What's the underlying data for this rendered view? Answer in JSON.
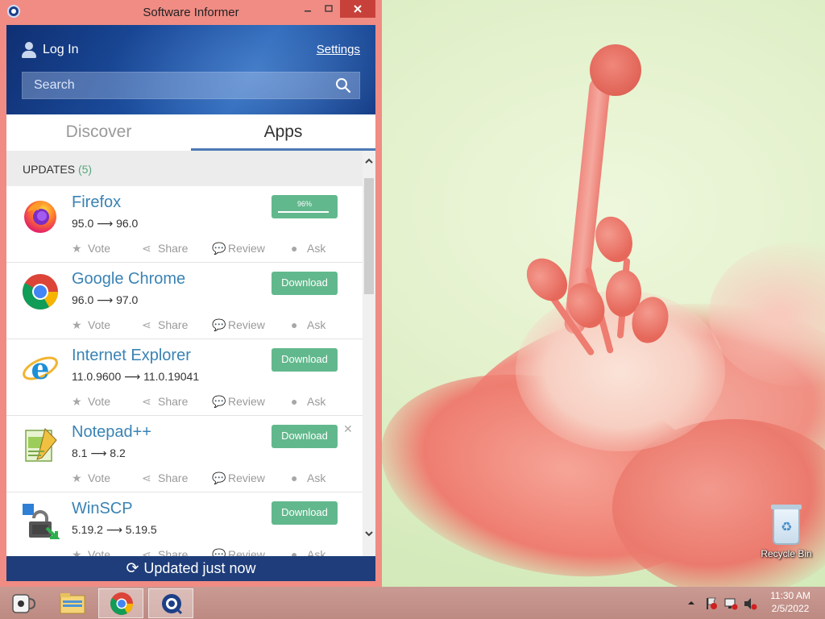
{
  "window": {
    "title": "Software Informer",
    "minimize": "▭",
    "maximize": "□",
    "close": "✕"
  },
  "header": {
    "login_label": "Log In",
    "settings_label": "Settings",
    "search_placeholder": "Search"
  },
  "tabs": [
    {
      "label": "Discover",
      "active": false
    },
    {
      "label": "Apps",
      "active": true
    }
  ],
  "updates": {
    "label": "UPDATES",
    "count": "(5)"
  },
  "actions": {
    "vote": "Vote",
    "share": "Share",
    "review": "Review",
    "ask": "Ask"
  },
  "apps": [
    {
      "name": "Firefox",
      "version": "95.0 ⟶ 96.0",
      "status": "progress",
      "progress_label": "96%",
      "progress_value": 0.96,
      "icon": "firefox-icon"
    },
    {
      "name": "Google Chrome",
      "version": "96.0 ⟶ 97.0",
      "status": "download",
      "button": "Download",
      "icon": "chrome-icon"
    },
    {
      "name": "Internet Explorer",
      "version": "11.0.9600 ⟶ 11.0.19041",
      "status": "download",
      "button": "Download",
      "icon": "ie-icon"
    },
    {
      "name": "Notepad++",
      "version": "8.1 ⟶ 8.2",
      "status": "download",
      "button": "Download",
      "icon": "notepadpp-icon",
      "dismiss": "✕"
    },
    {
      "name": "WinSCP",
      "version": "5.19.2 ⟶ 5.19.5",
      "status": "download",
      "button": "Download",
      "icon": "winscp-icon"
    }
  ],
  "footer": {
    "label": "Updated just now"
  },
  "desktop": {
    "recycle_bin_label": "Recycle Bin"
  },
  "taskbar": {
    "items": [
      "coffee-app-icon",
      "file-explorer-icon",
      "chrome-icon",
      "software-informer-icon"
    ],
    "clock_time": "11:30 AM",
    "clock_date": "2/5/2022"
  },
  "colors": {
    "accent_green": "#62b88d",
    "link_blue": "#3a83b4",
    "header_blue": "#1b4c9c",
    "window_frame": "#f08c84"
  }
}
